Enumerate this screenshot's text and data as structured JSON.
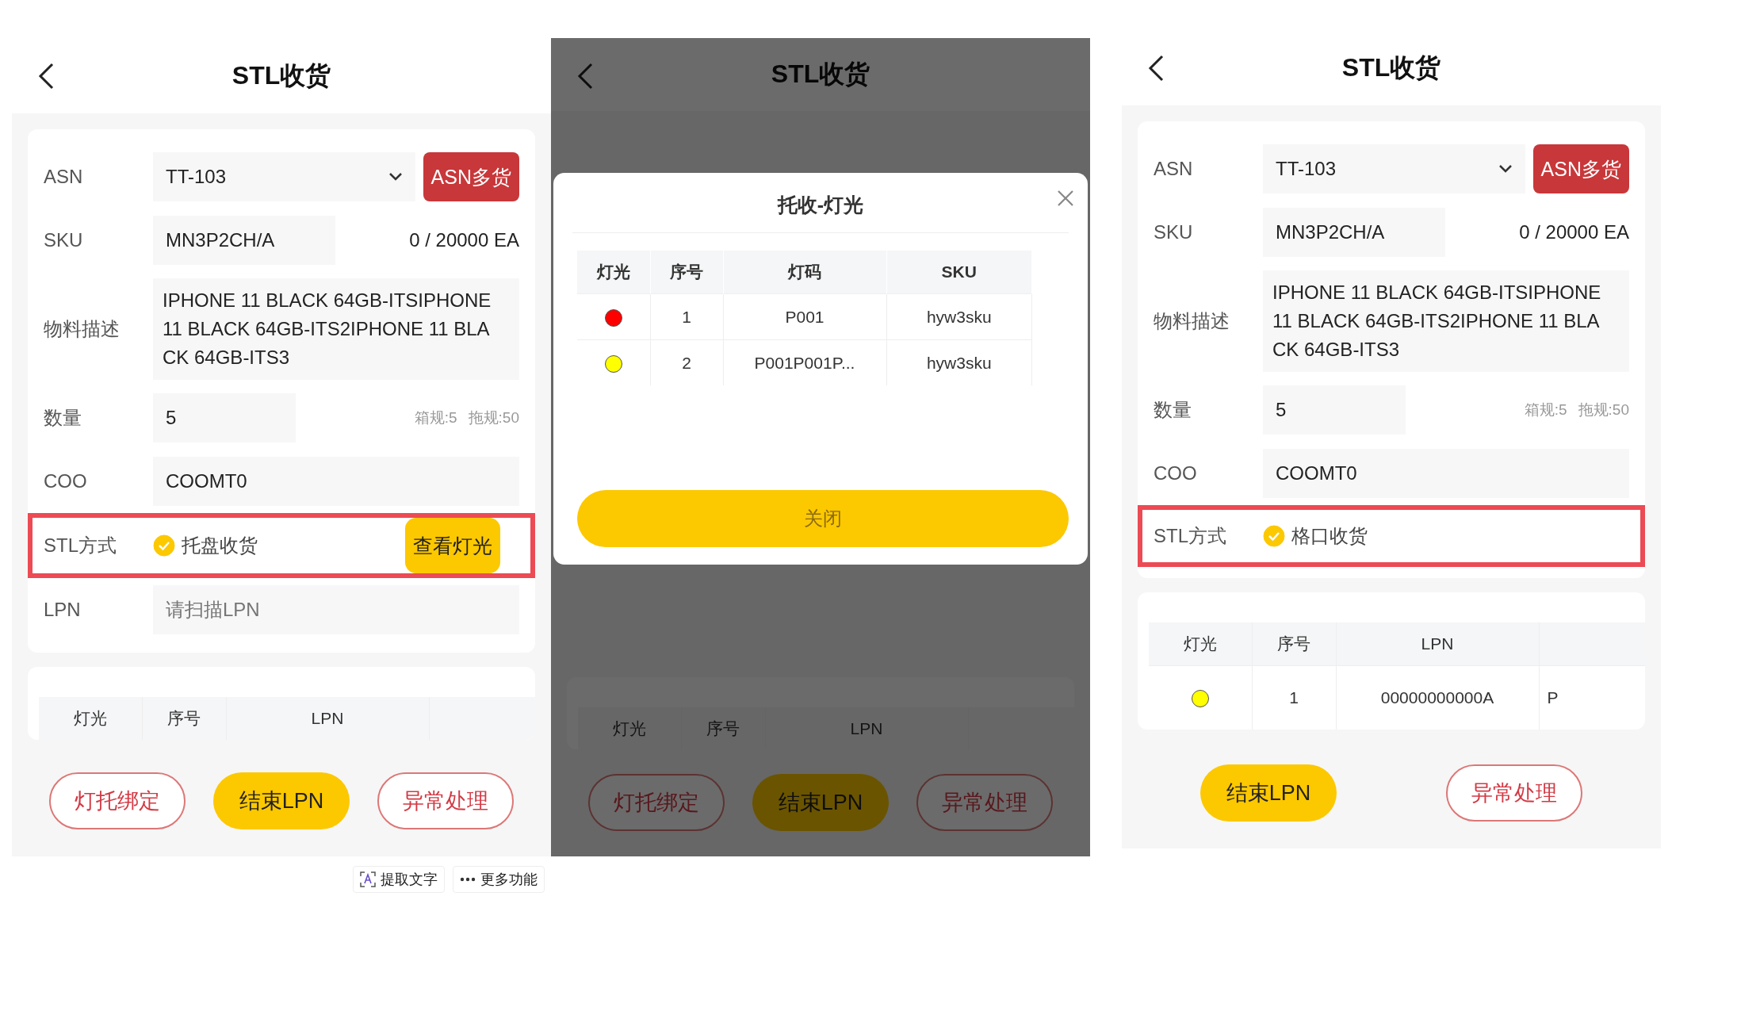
{
  "screens": [
    {
      "kind": "form",
      "title": "STL收货",
      "fields": [
        {
          "kind": "select",
          "label": "ASN",
          "value": "TT-103",
          "button": "ASN多货"
        },
        {
          "kind": "field",
          "label": "SKU",
          "value": "MN3P2CH/A",
          "notes": [
            "0 / 20000 EA"
          ]
        },
        {
          "kind": "textarea",
          "label": "物料描述",
          "value": "IPHONE 11 BLACK 64GB-ITSIPHONE 11 BLACK 64GB-ITS2IPHONE 11 BLACK 64GB-ITS3"
        },
        {
          "kind": "field",
          "label": "数量",
          "value": "5",
          "notes": [
            "箱规:5",
            "拖规:50"
          ],
          "small": true
        },
        {
          "kind": "field",
          "label": "COO",
          "value": "COOMT0"
        },
        {
          "kind": "radio",
          "label": "STL方式",
          "option": "托盘收货",
          "checked": true,
          "button": "查看灯光",
          "highlighted": true
        },
        {
          "kind": "input",
          "label": "LPN",
          "placeholder": "请扫描LPN"
        }
      ],
      "table": {
        "columns": [
          "灯光",
          "序号",
          "LPN"
        ]
      },
      "buttons": [
        {
          "label": "灯托绑定",
          "kind": "outline"
        },
        {
          "label": "结束LPN",
          "kind": "primary"
        },
        {
          "label": "异常处理",
          "kind": "outline"
        }
      ],
      "toolbar": [
        {
          "label": "提取文字",
          "kind": "extract"
        },
        {
          "label": "更多功能",
          "kind": "more"
        }
      ]
    },
    {
      "kind": "dialog",
      "title": "STL收货",
      "table": {
        "columns": [
          "灯光",
          "序号",
          "LPN"
        ]
      },
      "buttons": [
        {
          "label": "灯托绑定",
          "kind": "outline"
        },
        {
          "label": "结束LPN",
          "kind": "primary"
        },
        {
          "label": "异常处理",
          "kind": "outline"
        }
      ],
      "dialog": {
        "title": "托收-灯光",
        "columns": [
          "灯光",
          "序号",
          "灯码",
          "SKU"
        ],
        "rows": [
          {
            "color": "#ff0000",
            "cells": [
              "",
              "1",
              "P001",
              "hyw3sku"
            ]
          },
          {
            "color": "#ffff00",
            "cells": [
              "",
              "2",
              "P001P001P...",
              "hyw3sku"
            ]
          }
        ],
        "close": "关闭"
      }
    },
    {
      "kind": "form",
      "title": "STL收货",
      "fields": [
        {
          "kind": "select",
          "label": "ASN",
          "value": "TT-103",
          "button": "ASN多货"
        },
        {
          "kind": "field",
          "label": "SKU",
          "value": "MN3P2CH/A",
          "notes": [
            "0 / 20000 EA"
          ]
        },
        {
          "kind": "textarea",
          "label": "物料描述",
          "value": "IPHONE 11 BLACK 64GB-ITSIPHONE 11 BLACK 64GB-ITS2IPHONE 11 BLACK 64GB-ITS3"
        },
        {
          "kind": "field",
          "label": "数量",
          "value": "5",
          "notes": [
            "箱规:5",
            "拖规:50"
          ],
          "small": true
        },
        {
          "kind": "field",
          "label": "COO",
          "value": "COOMT0"
        },
        {
          "kind": "radio",
          "label": "STL方式",
          "option": "格口收货",
          "checked": true,
          "highlighted": true
        }
      ],
      "table": {
        "columns": [
          "灯光",
          "序号",
          "LPN"
        ],
        "rows": [
          {
            "color": "#ffff00",
            "cells": [
              "",
              "1",
              "00000000000A",
              "P"
            ]
          }
        ]
      },
      "buttons": [
        {
          "label": "结束LPN",
          "kind": "primary"
        },
        {
          "label": "异常处理",
          "kind": "outline"
        }
      ]
    }
  ]
}
